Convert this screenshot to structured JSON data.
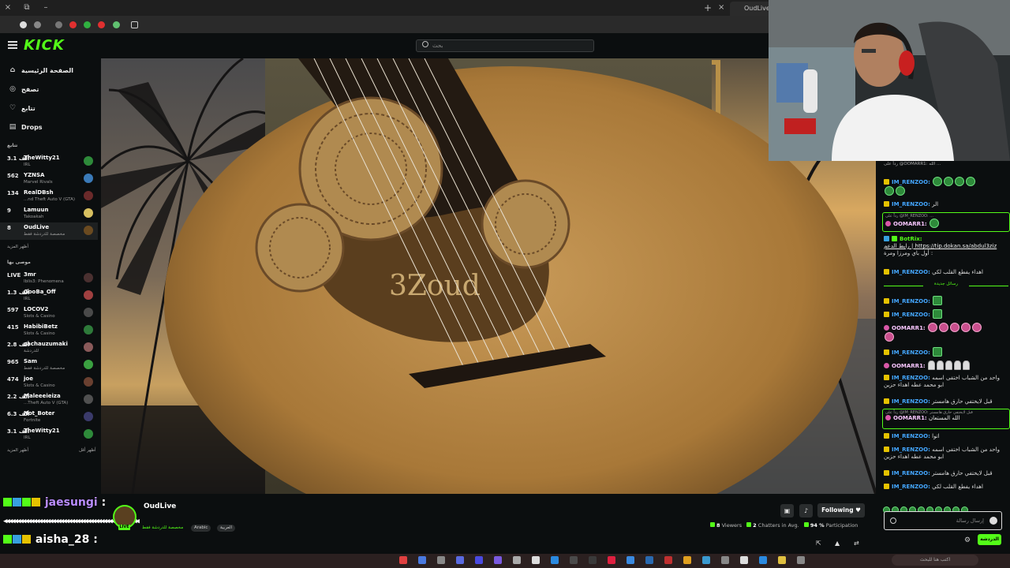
{
  "browser": {
    "tab_title": "OudLive Stream",
    "window_close": "×",
    "window_restore": "⧉",
    "window_min": "–",
    "new_tab": "+",
    "tab_close": "×"
  },
  "header": {
    "logo": "KICK",
    "search_placeholder": "بحث"
  },
  "sidebar": {
    "nav": [
      {
        "label": "الصفحة الرئيسية",
        "icon": "home-icon",
        "glyph": "⌂"
      },
      {
        "label": "تصفح",
        "icon": "compass-icon",
        "glyph": "◎"
      },
      {
        "label": "تتابع",
        "icon": "heart-icon",
        "glyph": "♡"
      },
      {
        "label": "Drops",
        "icon": "drops-icon",
        "glyph": "▤"
      }
    ],
    "following_title": "تتابع",
    "following": [
      {
        "viewers": "3.1 ألف",
        "name": "TheWitty21",
        "category": "IRL",
        "color": "#2e8a3a"
      },
      {
        "viewers": "562",
        "name": "YZNSA",
        "category": "Marvel Rivals",
        "color": "#3a7ab8"
      },
      {
        "viewers": "134",
        "name": "RealDBsh",
        "category": "...nd Theft Auto V (GTA)",
        "color": "#6a2a2a"
      },
      {
        "viewers": "9",
        "name": "Lamuun",
        "category": "Takoakah",
        "color": "#d8c060"
      },
      {
        "viewers": "8",
        "name": "OudLive",
        "category": "مخصصة للدردشة فقط",
        "color": "#6a4a20"
      }
    ],
    "show_more_1": "أظهر المزيد",
    "recommended_title": "موصى بها",
    "recommended": [
      {
        "viewers": "LIVE",
        "name": "3mr",
        "category": "Iblis3: Phenomena",
        "color": "#4a3030"
      },
      {
        "viewers": "1.3 ألف",
        "name": "GooBa_Off",
        "category": "IRL",
        "color": "#a04040"
      },
      {
        "viewers": "597",
        "name": "LOCOV2",
        "category": "Slots & Casino",
        "color": "#4a4a4a"
      },
      {
        "viewers": "415",
        "name": "HabibiBetz",
        "category": "Slots & Casino",
        "color": "#2e7a3a"
      },
      {
        "viewers": "2.8 ألف",
        "name": "sachauzumaki",
        "category": "للدردشة",
        "color": "#8a5a5a"
      },
      {
        "viewers": "965",
        "name": "Sam",
        "category": "مخصصة للدردشة فقط",
        "color": "#3aa040"
      },
      {
        "viewers": "474",
        "name": "joe",
        "category": "Slots & Casino",
        "color": "#6a4030"
      },
      {
        "viewers": "2.2 ألف",
        "name": "Maleeeieiza",
        "category": "...Theft Auto V (GTA)",
        "color": "#505050"
      },
      {
        "viewers": "6.3 ألف",
        "name": "Not_Boter",
        "category": "Fortnite",
        "color": "#3a3a6a"
      },
      {
        "viewers": "3.1 ألف",
        "name": "TheWitty21",
        "category": "IRL",
        "color": "#2e8a3a"
      }
    ],
    "show_more_2": "أظهر المزيد",
    "show_less": "أظهر أقل"
  },
  "stream": {
    "oud_text": "3Zoud"
  },
  "overlay": {
    "line1_user": "jaesungi",
    "line2_user": "aisha_28",
    "waves": "◀◀◀◀◀◀◀◀◀◀◀◀◀◀◀◀◀◀◀◀◀◀◀◀◀◀◀◀◀◀◀◀◀◀◀◀◀◀◀◀◀◀◀◀◀◀◀◀◀◀"
  },
  "streamer": {
    "name": "OudLive",
    "live": "LIVE",
    "category": "مخصصة للدردشة فقط",
    "tags": [
      "Arabic",
      "العربية"
    ],
    "follow_label": "Following ♥",
    "viewers": "8",
    "viewers_label": "Viewers",
    "chatters": "2",
    "chatters_label": "Chatters in Avg.",
    "participation": "94 %",
    "participation_label": "Participation"
  },
  "chat": {
    "messages": [
      {
        "user": "IM_RENZOO:",
        "text": "الر"
      },
      {
        "user": "OOMARR1:",
        "text": ""
      },
      {
        "user": "BotRix:",
        "text": "رابط الدعم | https://tip.dokan.sa/abdul3ziz",
        "text2": "أول باي ومرزا ومرة :"
      },
      {
        "user": "IM_RENZOO:",
        "text": "اهداء يفطع القلب لكي"
      },
      {
        "user": "IM_RENZOO:",
        "text": ""
      },
      {
        "user": "IM_RENZOO:",
        "text": ""
      },
      {
        "user": "OOMARR1:",
        "text": ""
      },
      {
        "user": "IM_RENZOO:",
        "text": ""
      },
      {
        "user": "OOMARR1:",
        "text": ""
      },
      {
        "user": "IM_RENZOO:",
        "text": "واحد من الشباب اختفى اسمه",
        "text2": "ابو محمد عطه اهداء حزين"
      },
      {
        "user": "IM_RENZOO:",
        "text": "قبل لايختفي حارق هامستر"
      },
      {
        "user": "OOMARR1:",
        "text": "الله المستعان"
      },
      {
        "user": "IM_RENZOO:",
        "text": "اتوا"
      },
      {
        "user": "IM_RENZOO:",
        "text": "واحد من الشباب اختفى اسمه",
        "text2": "ابو محمد عطه اهداء حزين"
      },
      {
        "user": "IM_RENZOO:",
        "text": "قبل لايختفي حارق هامستر"
      },
      {
        "user": "IM_RENZOO:",
        "text": "اهداء يفطع القلب لكي"
      }
    ],
    "reply_hint_1": "رداً على @IM_RENZOO: ...",
    "reply_hint_2": "رداً على @IM_RENZOO: قبل لايختفي حارق هامستر",
    "reply_hint_top": "رداً على @OOMARR1: الله ...",
    "new_messages": "رسائل جديدة",
    "input_placeholder": "إرسال رسالة",
    "send_label": "الدردشة"
  },
  "taskbar": {
    "search_placeholder": "اكتب هنا للبحث"
  }
}
